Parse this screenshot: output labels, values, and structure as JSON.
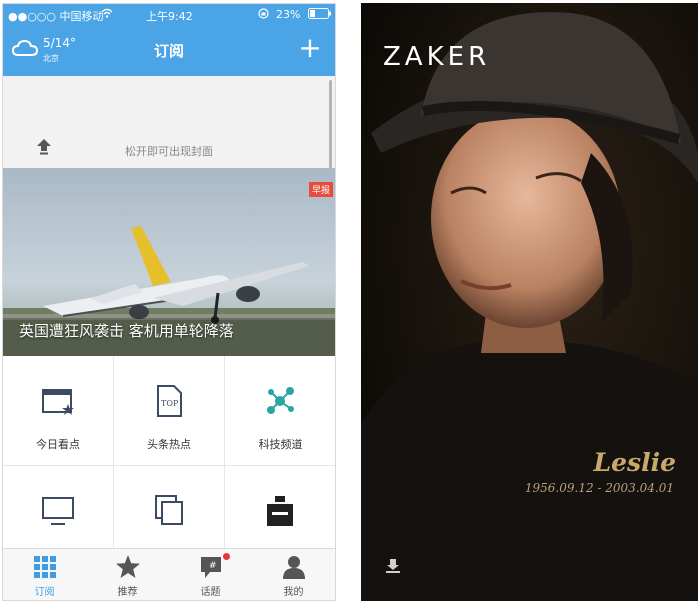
{
  "left_phone": {
    "status": {
      "carrier": "●●○○○ 中国移动",
      "time": "上午9:42",
      "battery": "23%"
    },
    "header": {
      "weather_temp": "5/14°",
      "weather_city": "北京",
      "title": "订阅",
      "add_label": "+"
    },
    "pull_hint": "松开即可出现封面",
    "banner": {
      "badge": "早报",
      "caption": "英国遭狂风袭击 客机用单轮降落",
      "page_count": 4,
      "active_index": 0
    },
    "grid_items": [
      {
        "label": "今日看点",
        "icon": "calendar-star-icon"
      },
      {
        "label": "头条热点",
        "icon": "top-document-icon"
      },
      {
        "label": "科技频道",
        "icon": "molecule-network-icon"
      },
      {
        "label": "",
        "icon": "monitor-icon"
      },
      {
        "label": "",
        "icon": "stacked-photos-icon"
      },
      {
        "label": "",
        "icon": "perfume-bottle-icon"
      }
    ],
    "tabs": [
      {
        "label": "订阅",
        "icon": "grid-icon",
        "active": true
      },
      {
        "label": "推荐",
        "icon": "star-icon",
        "active": false
      },
      {
        "label": "话题",
        "icon": "chat-icon",
        "active": false,
        "has_badge": true
      },
      {
        "label": "我的",
        "icon": "person-icon",
        "active": false
      }
    ],
    "colors": {
      "accent": "#4aa4e6",
      "badge": "#e74c3c"
    }
  },
  "right_phone": {
    "logo": "ZAKER",
    "name": "Leslie",
    "dates": "1956.09.12 - 2003.04.01",
    "colors": {
      "name": "#c8a96a",
      "background": "#0b0907"
    }
  }
}
